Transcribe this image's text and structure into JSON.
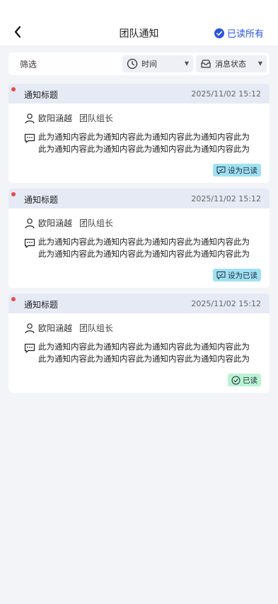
{
  "header": {
    "title": "团队通知",
    "read_all_label": "已读所有"
  },
  "filter": {
    "label": "筛选",
    "time_label": "时间",
    "status_label": "消息状态"
  },
  "notifications": [
    {
      "title": "通知标题",
      "time": "2025/11/02 15:12",
      "sender": "欧阳涵越",
      "role": "团队组长",
      "content_line1": "此为通知内容此为通知内容此为通知内容此为通知内容此为",
      "content_line2": "此为通知内容此为通知内容此为通知内容此为通知内容此为",
      "action_label": "设为已读",
      "is_read": false
    },
    {
      "title": "通知标题",
      "time": "2025/11/02 15:12",
      "sender": "欧阳涵越",
      "role": "团队组长",
      "content_line1": "此为通知内容此为通知内容此为通知内容此为通知内容此为",
      "content_line2": "此为通知内容此为通知内容此为通知内容此为通知内容此为",
      "action_label": "设为已读",
      "is_read": false
    },
    {
      "title": "通知标题",
      "time": "2025/11/02 15:12",
      "sender": "欧阳涵越",
      "role": "团队组长",
      "content_line1": "此为通知内容此为通知内容此为通知内容此为通知内容此为",
      "content_line2": "此为通知内容此为通知内容此为通知内容此为通知内容此为",
      "action_label": "已读",
      "is_read": true
    }
  ],
  "colors": {
    "accent": "#2b54e0",
    "unread_dot": "#e64a4a",
    "card_header": "#e6eaf5",
    "unread_button": "#9fe0f3",
    "read_button": "#baf3d2"
  }
}
